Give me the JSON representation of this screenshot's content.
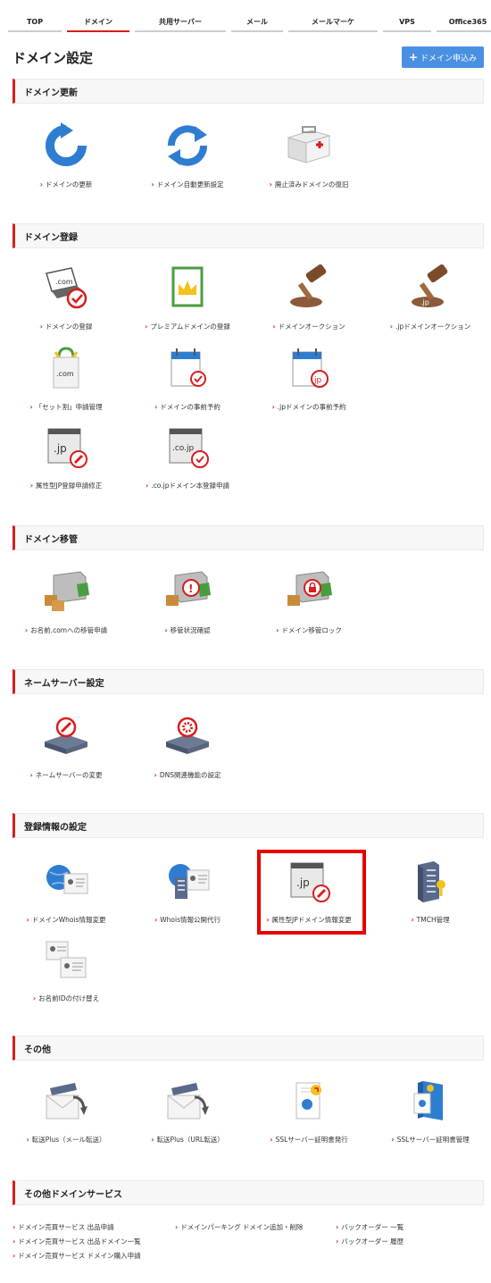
{
  "nav": {
    "tabs": [
      "TOP",
      "ドメイン",
      "共用サーバー",
      "メール",
      "メールマーケ",
      "VPS",
      "Office365"
    ]
  },
  "page_title": "ドメイン設定",
  "apply_button": {
    "label": "ドメイン申込み"
  },
  "colors": {
    "accent": "#d81e1e",
    "button": "#4a90e2",
    "highlight": "#e60000"
  },
  "sections": {
    "renew": {
      "title": "ドメイン更新",
      "items": [
        "ドメインの更新",
        "ドメイン自動更新設定",
        "廃止済みドメインの復旧"
      ]
    },
    "register": {
      "title": "ドメイン登録",
      "items": [
        "ドメインの登録",
        "プレミアムドメインの登録",
        "ドメインオークション",
        ".jpドメインオークション",
        "「セット割」申請管理",
        "ドメインの事前予約",
        ".jpドメインの事前予約",
        "属性型JP登録申請修正",
        ".co.jpドメイン本登録申請"
      ]
    },
    "transfer": {
      "title": "ドメイン移管",
      "items": [
        "お名前.comへの移管申請",
        "移管状況確認",
        "ドメイン移管ロック"
      ]
    },
    "nameserver": {
      "title": "ネームサーバー設定",
      "items": [
        "ネームサーバーの変更",
        "DNS関連機能の設定"
      ]
    },
    "reginfo": {
      "title": "登録情報の設定",
      "items": [
        "ドメインWhois情報変更",
        "Whois情報公開代行",
        "属性型JPドメイン情報変更",
        "TMCH管理",
        "お名前IDの付け替え"
      ]
    },
    "other": {
      "title": "その他",
      "items": [
        "転送Plus（メール転送）",
        "転送Plus（URL転送）",
        "SSLサーバー証明書発行",
        "SSLサーバー証明書管理"
      ]
    },
    "other_services": {
      "title": "その他ドメインサービス",
      "links": [
        "ドメイン売買サービス 出品申請",
        "ドメイン売買サービス 出品ドメイン一覧",
        "ドメイン売買サービス ドメイン購入申請",
        "ドメインパーキング ドメイン追加・削除",
        "バックオーダー 一覧",
        "バックオーダー 履歴"
      ]
    }
  }
}
